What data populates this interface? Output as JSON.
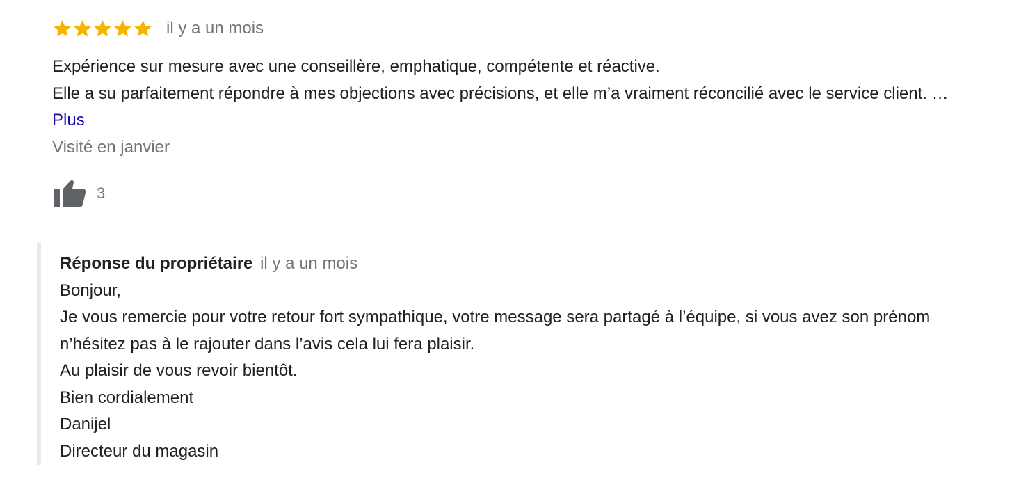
{
  "review": {
    "rating": 5,
    "rating_max": 5,
    "star_color": "#f4b400",
    "date": "il y a un mois",
    "text_line_1": "Expérience sur mesure avec une conseillère, emphatique, compétente et réactive.",
    "text_line_2": "Elle a su parfaitement répondre à mes objections avec précisions, et elle m’a vraiment réconcilié avec le service client. … ",
    "more_label": "Plus",
    "visited": "Visité en janvier",
    "like_icon": "thumbs-up-icon",
    "like_count": "3"
  },
  "owner_reply": {
    "author_label": "Réponse du propriétaire",
    "date": "il y a un mois",
    "lines": [
      "Bonjour,",
      "Je vous remercie pour votre retour fort sympathique, votre message sera partagé à l’équipe, si vous avez son prénom n’hésitez pas à le rajouter dans l’avis cela lui fera plaisir.",
      "Au plaisir de vous revoir bientôt.",
      "Bien cordialement",
      "Danijel",
      "Directeur du magasin"
    ]
  }
}
